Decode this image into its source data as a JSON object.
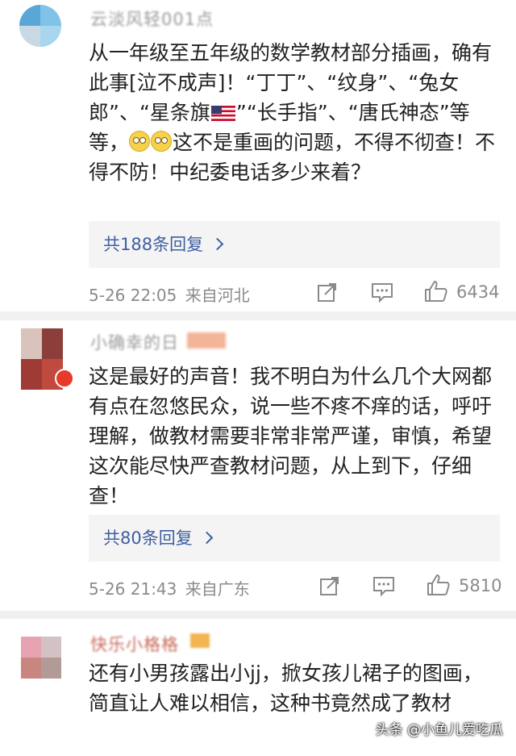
{
  "comments": [
    {
      "username": "云淡风轻001点",
      "body": {
        "part1": "从一年级至五年级的数学教材部分插画，确有此事[泣不成声]！“丁丁”、“纹身”、“兔女郎”、“星条旗",
        "part2": "”“长手指”、“唐氏神态”等等，",
        "part3": "这不是重画的问题，不得不彻查！不得不防！中纪委电话多少来着？"
      },
      "reply_count": "共188条回复",
      "time": "5-26 22:05",
      "location": "来自河北",
      "likes": "6434"
    },
    {
      "username": "小确幸的日",
      "body": "这是最好的声音！我不明白为什么几个大网都有点在忽悠民众，说一些不疼不痒的话，呼吁理解，做教材需要非常非常严谨，审慎，希望这次能尽快严查教材问题，从上到下，仔细查！",
      "reply_count": "共80条回复",
      "time": "5-26 21:43",
      "location": "来自广东",
      "likes": "5810"
    },
    {
      "username": "快乐小格格",
      "body": "还有小男孩露出小jj，掀女孩儿裙子的图画，简直让人难以相信，这种书竟然成了教材"
    }
  ],
  "icons": [
    "share-icon",
    "comment-icon",
    "thumbs-up-icon",
    "flag-icon",
    "emoji-icon"
  ],
  "watermark": "头条 @小鱼儿爱吃瓜",
  "colors": {
    "reply_link": "#3f5fa0",
    "reply_bg": "#f4f4f5",
    "meta": "#8a8a8a",
    "divider": "#f0f0f0"
  }
}
